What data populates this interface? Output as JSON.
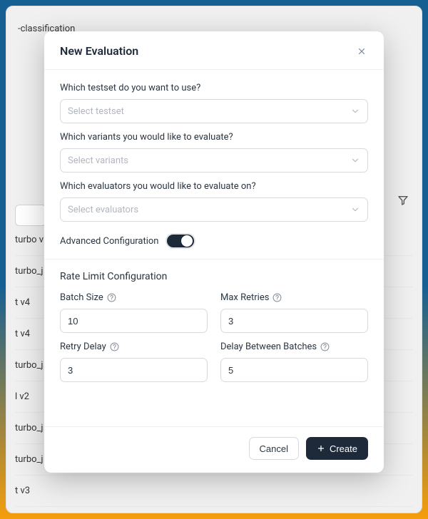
{
  "breadcrumb": "-classification",
  "bg_rows": [
    "turbo v",
    "turbo_j",
    "t v4",
    "t v4",
    "turbo_j",
    "l v2",
    "turbo_j",
    "turbo_j",
    "t v3"
  ],
  "modal": {
    "title": "New Evaluation",
    "testset": {
      "label": "Which testset do you want to use?",
      "placeholder": "Select testset"
    },
    "variants": {
      "label": "Which variants you would like to evaluate?",
      "placeholder": "Select variants"
    },
    "evaluators": {
      "label": "Which evaluators you would like to evaluate on?",
      "placeholder": "Select evaluators"
    },
    "advanced_label": "Advanced Configuration",
    "rate_limit_heading": "Rate Limit Configuration",
    "fields": {
      "batch_size": {
        "label": "Batch Size",
        "value": "10"
      },
      "max_retries": {
        "label": "Max Retries",
        "value": "3"
      },
      "retry_delay": {
        "label": "Retry Delay",
        "value": "3"
      },
      "delay_between_batches": {
        "label": "Delay Between Batches",
        "value": "5"
      }
    },
    "footer": {
      "cancel": "Cancel",
      "create": "Create"
    }
  }
}
